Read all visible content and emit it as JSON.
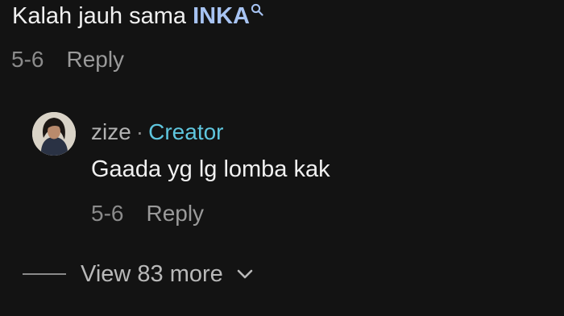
{
  "parent_comment": {
    "text_prefix": "Kalah jauh sama ",
    "keyword": "INKA",
    "keyword_icon": "search-icon",
    "date": "5-6",
    "reply_label": "Reply"
  },
  "reply_comment": {
    "author": "zize",
    "separator": "·",
    "badge": "Creator",
    "text": "Gaada yg lg lomba kak",
    "date": "5-6",
    "reply_label": "Reply",
    "avatar_icon": "user-avatar"
  },
  "view_more": {
    "label": "View 83 more",
    "icon": "chevron-down-icon"
  },
  "colors": {
    "background": "#131313",
    "keyword": "#a7c3f2",
    "creator_badge": "#5fc6de",
    "muted": "#8b8b8b"
  }
}
